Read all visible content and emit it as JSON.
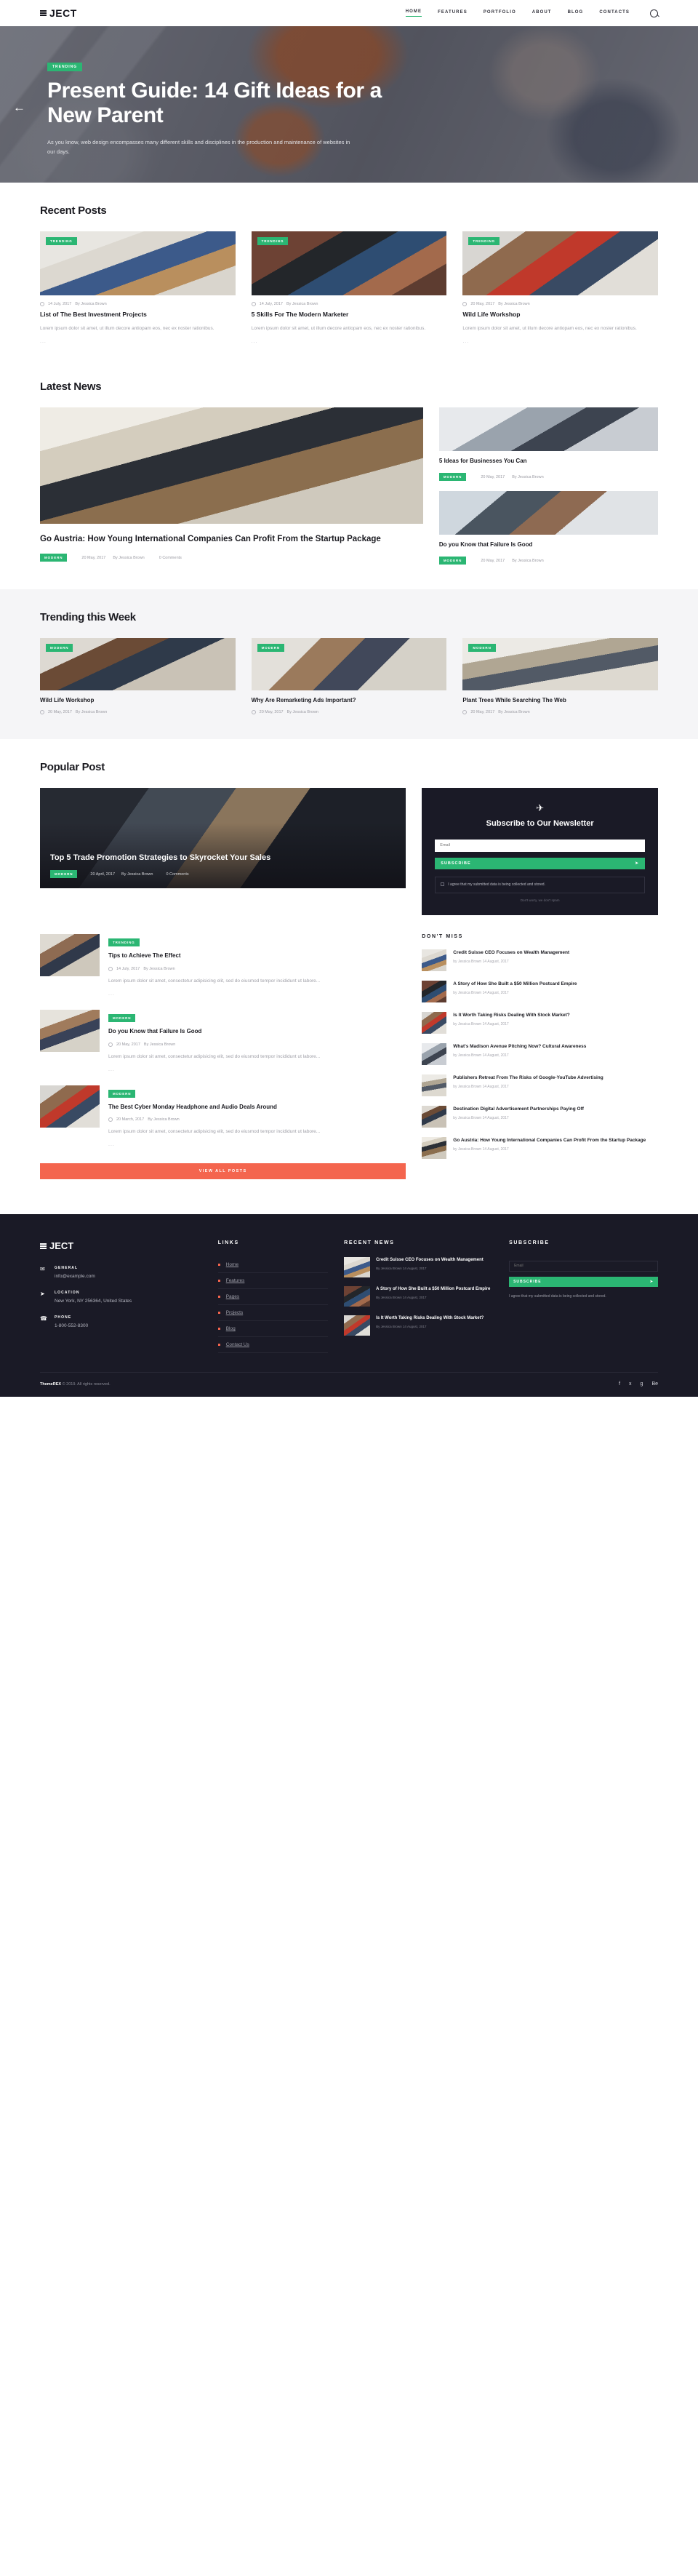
{
  "site": {
    "logo": "JECT",
    "nav": [
      {
        "label": "HOME",
        "active": true
      },
      {
        "label": "FEATURES",
        "active": false
      },
      {
        "label": "PORTFOLIO",
        "active": false
      },
      {
        "label": "ABOUT",
        "active": false
      },
      {
        "label": "BLOG",
        "active": false
      },
      {
        "label": "CONTACTS",
        "active": false
      }
    ],
    "search_icon": "search-icon"
  },
  "hero": {
    "badge": "TRENDING",
    "title": "Present Guide: 14 Gift Ideas for a New Parent",
    "excerpt": "As you know, web design encompasses many different skills and disciplines in the production and maintenance of websites in our days.",
    "prev_arrow": "←"
  },
  "recent": {
    "title": "Recent Posts",
    "posts": [
      {
        "badge": "TRENDING",
        "date": "14 July, 2017",
        "author": "By Jessica Brown",
        "title": "List of The Best Investment Projects",
        "excerpt": "Lorem ipsum dolor sit amet, ut illum decore antiopam eos, nec ex noster rationibus.",
        "more": "..."
      },
      {
        "badge": "TRENDING",
        "date": "14 July, 2017",
        "author": "By Jessica Brown",
        "title": "5 Skills For The Modern Marketer",
        "excerpt": "Lorem ipsum dolor sit amet, ut illum decore antiopam eos, nec ex noster rationibus.",
        "more": "..."
      },
      {
        "badge": "TRENDING",
        "date": "20 May, 2017",
        "author": "By Jessica Brown",
        "title": "Wild Life Workshop",
        "excerpt": "Lorem ipsum dolor sit amet, ut illum decore antiopam eos, nec ex noster rationibus.",
        "more": "..."
      }
    ]
  },
  "latest": {
    "title": "Latest News",
    "main": {
      "title": "Go Austria: How Young International Companies Can Profit From the Startup Package",
      "badge": "MODERN",
      "date": "20 May, 2017",
      "author": "By Jessica Brown",
      "comments": "0 Comments"
    },
    "side": [
      {
        "title": "5 Ideas for Businesses You Can",
        "badge": "MODERN",
        "date": "20 May, 2017",
        "author": "By Jessica Brown"
      },
      {
        "title": "Do you Know that Failure Is Good",
        "badge": "MODERN",
        "date": "20 May, 2017",
        "author": "By Jessica Brown"
      }
    ]
  },
  "trending": {
    "title": "Trending this Week",
    "posts": [
      {
        "badge": "MODERN",
        "title": "Wild Life Workshop",
        "date": "20 May, 2017",
        "author": "By Jessica Brown"
      },
      {
        "badge": "MODERN",
        "title": "Why Are Remarketing Ads Important?",
        "date": "20 May, 2017",
        "author": "By Jessica Brown"
      },
      {
        "badge": "MODERN",
        "title": "Plant Trees While Searching The Web",
        "date": "20 May, 2017",
        "author": "By Jessica Brown"
      }
    ]
  },
  "popular": {
    "title": "Popular Post",
    "feature": {
      "title": "Top 5 Trade Promotion Strategies to Skyrocket Your Sales",
      "badge": "MODERN",
      "date": "20 April, 2017",
      "author": "By Jessica Brown",
      "comments": "0 Comments"
    },
    "newsletter": {
      "heading": "Subscribe to Our Newsletter",
      "email_placeholder": "Email",
      "button": "SUBSCRIBE",
      "consent": "I agree that my submitted data is being collected and stored.",
      "spam_note": "Don't worry, we don't spam"
    },
    "list": [
      {
        "badge": "TRENDING",
        "title": "Tips to Achieve The Effect",
        "date": "14 July, 2017",
        "author": "By Jessica Brown",
        "excerpt": "Lorem ipsum dolor sit amet, consectetur adipisicing elit, sed do eiusmod tempor incididunt ut labore...",
        "more": "..."
      },
      {
        "badge": "MODERN",
        "title": "Do you Know that Failure Is Good",
        "date": "20 May, 2017",
        "author": "By Jessica Brown",
        "excerpt": "Lorem ipsum dolor sit amet, consectetur adipisicing elit, sed do eiusmod tempor incididunt ut labore...",
        "more": "..."
      },
      {
        "badge": "MODERN",
        "title": "The Best Cyber Monday Headphone and Audio Deals Around",
        "date": "20 March, 2017",
        "author": "By Jessica Brown",
        "excerpt": "Lorem ipsum dolor sit amet, consectetur adipisicing elit, sed do eiusmod tempor incididunt ut labore...",
        "more": "..."
      }
    ],
    "view_all": "VIEW ALL POSTS"
  },
  "dont_miss": {
    "title": "DON'T MISS",
    "items": [
      {
        "title": "Credit Suisse CEO Focuses on Wealth Management",
        "meta": "by Jessica Brown  14 August, 2017"
      },
      {
        "title": "A Story of How She Built a $50 Million Postcard Empire",
        "meta": "by Jessica Brown  14 August, 2017"
      },
      {
        "title": "Is It Worth Taking Risks Dealing With Stock Market?",
        "meta": "by Jessica Brown  14 August, 2017"
      },
      {
        "title": "What's Madison Avenue Pitching Now? Cultural Awareness",
        "meta": "by Jessica Brown  14 August, 2017"
      },
      {
        "title": "Publishers Retreat From The Risks of Google-YouTube Advertising",
        "meta": "by Jessica Brown  14 August, 2017"
      },
      {
        "title": "Destination Digital Advertisement Partnerships Paying Off",
        "meta": "by Jessica Brown  14 August, 2017"
      },
      {
        "title": "Go Austria: How Young International Companies Can Profit From the Startup Package",
        "meta": "by Jessica Brown  14 August, 2017"
      }
    ]
  },
  "footer": {
    "logo": "JECT",
    "contacts": [
      {
        "icon": "mail-icon",
        "label": "GENERAL",
        "value": "info@example.com"
      },
      {
        "icon": "send-icon",
        "label": "LOCATION",
        "value": "New York, NY 256364, United States"
      },
      {
        "icon": "phone-icon",
        "label": "PHONE",
        "value": "1-800-552-8300"
      }
    ],
    "links_title": "LINKS",
    "links": [
      "Home",
      "Features",
      "Pages",
      "Projects",
      "Blog",
      "Contact Us"
    ],
    "recent_title": "RECENT NEWS",
    "recent": [
      {
        "title": "Credit Suisse CEO Focuses on Wealth Management",
        "meta": "By Jessica Brown  14 August, 2017"
      },
      {
        "title": "A Story of How She Built a $50 Million Postcard Empire",
        "meta": "By Jessica Brown  14 August, 2017"
      },
      {
        "title": "Is It Worth Taking Risks Dealing With Stock Market?",
        "meta": "By Jessica Brown  14 August, 2017"
      }
    ],
    "subscribe_title": "SUBSCRIBE",
    "email_placeholder": "Email",
    "subscribe_button": "SUBSCRIBE",
    "agree": "I agree that my submitted data is being collected and stored.",
    "copyright_brand": "ThemeREX",
    "copyright_rest": " © 2019. All rights reserved.",
    "socials": [
      "facebook-icon",
      "twitter-icon",
      "google-plus-icon",
      "behance-icon"
    ]
  },
  "colors": {
    "green": "#2bb673",
    "coral": "#f4654e",
    "dark": "#1a1a26"
  }
}
